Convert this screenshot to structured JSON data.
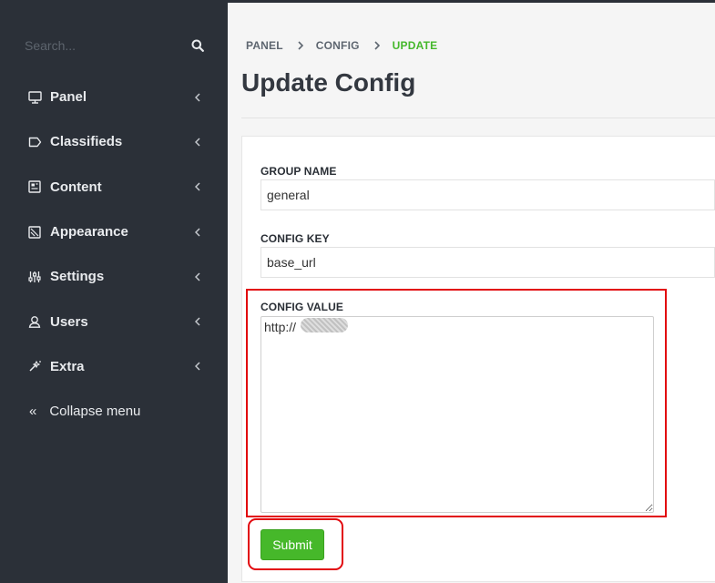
{
  "sidebar": {
    "search": {
      "placeholder": "Search..."
    },
    "items": [
      {
        "label": "Panel",
        "icon": "monitor-icon"
      },
      {
        "label": "Classifieds",
        "icon": "tag-icon"
      },
      {
        "label": "Content",
        "icon": "content-icon"
      },
      {
        "label": "Appearance",
        "icon": "appearance-icon"
      },
      {
        "label": "Settings",
        "icon": "sliders-icon"
      },
      {
        "label": "Users",
        "icon": "user-icon"
      },
      {
        "label": "Extra",
        "icon": "wand-icon"
      }
    ],
    "collapse_label": "Collapse menu"
  },
  "breadcrumb": [
    "PANEL",
    "CONFIG",
    "UPDATE"
  ],
  "page_title": "Update Config",
  "form": {
    "group_name": {
      "label": "GROUP NAME",
      "value": "general"
    },
    "config_key": {
      "label": "CONFIG KEY",
      "value": "base_url"
    },
    "config_value": {
      "label": "CONFIG VALUE",
      "value": "http://"
    },
    "submit_label": "Submit"
  },
  "colors": {
    "sidebar_bg": "#2b3038",
    "accent_green": "#46b82a",
    "highlight_red": "#e2080e"
  }
}
